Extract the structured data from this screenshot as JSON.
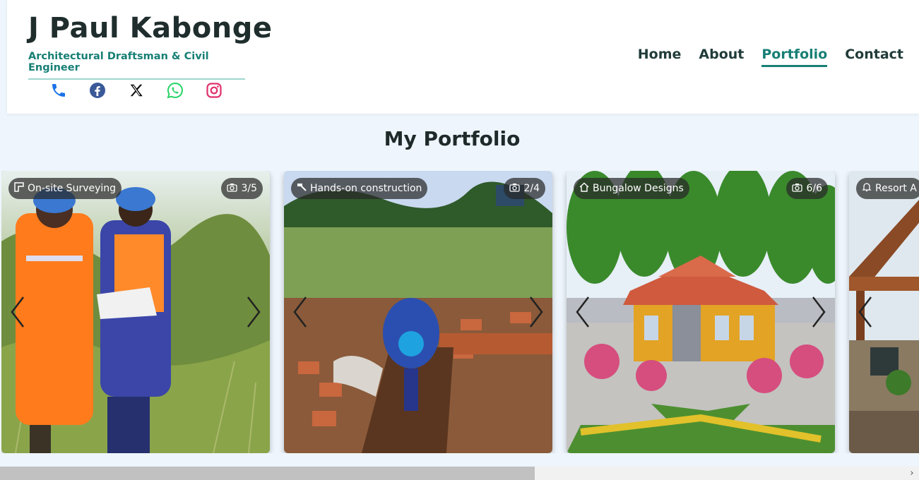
{
  "site": {
    "name": "J Paul Kabonge",
    "tagline": "Architectural Draftsman & Civil Engineer"
  },
  "socials": [
    {
      "icon": "phone-icon",
      "color": "#1a73e8"
    },
    {
      "icon": "facebook-icon",
      "color": "#3b5998"
    },
    {
      "icon": "x-icon",
      "color": "#000000"
    },
    {
      "icon": "whatsapp-icon",
      "color": "#25d366"
    },
    {
      "icon": "instagram-icon",
      "color": "#e1306c"
    }
  ],
  "nav": {
    "home": "Home",
    "about": "About",
    "portfolio": "Portfolio",
    "contact": "Contact",
    "active": "Portfolio"
  },
  "page": {
    "title": "My Portfolio"
  },
  "cards": [
    {
      "tag": "On-site Surveying",
      "tag_icon": "ruler-icon",
      "counter": "3/5"
    },
    {
      "tag": "Hands-on construction",
      "tag_icon": "hammer-icon",
      "counter": "2/4"
    },
    {
      "tag": "Bungalow Designs",
      "tag_icon": "house-icon",
      "counter": "6/6"
    },
    {
      "tag": "Resort A",
      "tag_icon": "bell-icon",
      "counter": ""
    }
  ],
  "theme": {
    "accent": "#177f75",
    "background": "#eef5fc"
  }
}
